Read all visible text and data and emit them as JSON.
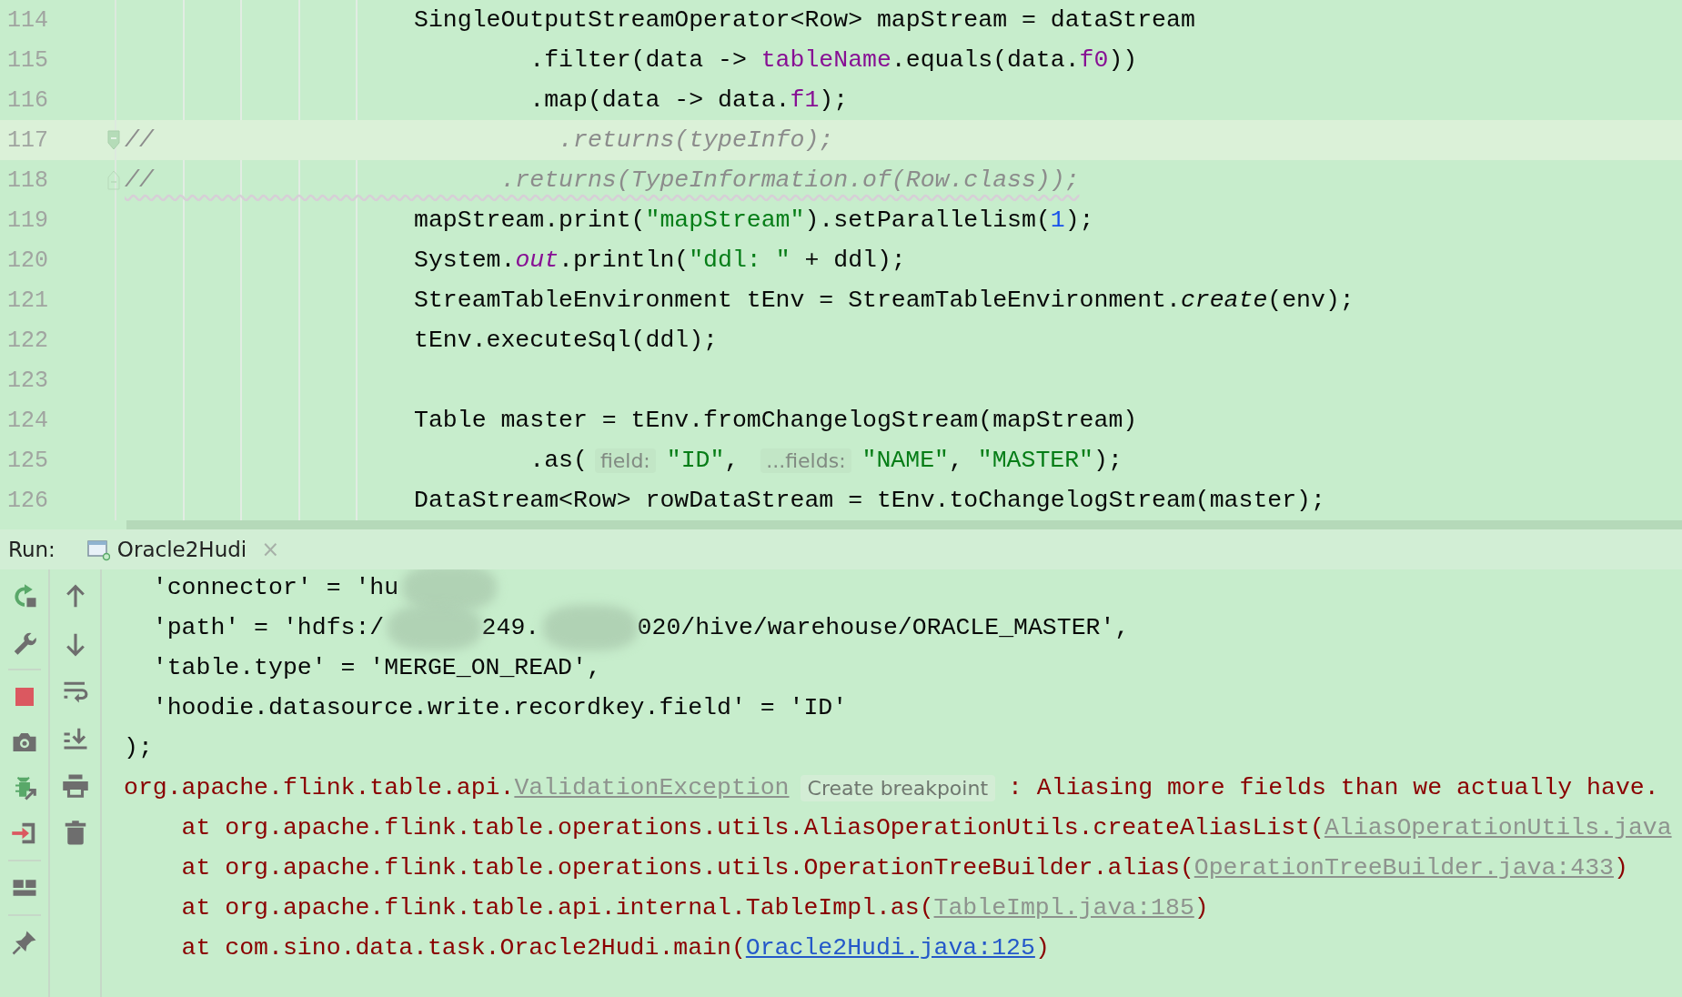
{
  "editor": {
    "lines": [
      {
        "number": "114",
        "kind": "code",
        "current": false,
        "warning": false,
        "tokens": [
          {
            "kind": "plain",
            "text": "                    SingleOutputStreamOperator<Row> mapStream = dataStream"
          }
        ]
      },
      {
        "number": "115",
        "kind": "code",
        "current": false,
        "warning": false,
        "tokens": [
          {
            "kind": "plain",
            "text": "                            .filter(data -> "
          },
          {
            "kind": "field",
            "text": "tableName"
          },
          {
            "kind": "plain",
            "text": ".equals(data."
          },
          {
            "kind": "field",
            "text": "f0"
          },
          {
            "kind": "plain",
            "text": "))"
          }
        ]
      },
      {
        "number": "116",
        "kind": "code",
        "current": false,
        "warning": false,
        "tokens": [
          {
            "kind": "plain",
            "text": "                            .map(data -> data."
          },
          {
            "kind": "field",
            "text": "f1"
          },
          {
            "kind": "plain",
            "text": ");"
          }
        ]
      },
      {
        "number": "117",
        "kind": "fold-start",
        "current": true,
        "warning": false,
        "tokens": [
          {
            "kind": "comment",
            "text": "//                            .returns(typeInfo);"
          }
        ]
      },
      {
        "number": "118",
        "kind": "fold-end",
        "current": false,
        "warning": true,
        "tokens": [
          {
            "kind": "comment",
            "text": "//                        .returns(TypeInformation.of(Row.class));"
          }
        ]
      },
      {
        "number": "119",
        "kind": "code",
        "current": false,
        "warning": false,
        "tokens": [
          {
            "kind": "plain",
            "text": "                    mapStream.print("
          },
          {
            "kind": "string",
            "text": "\"mapStream\""
          },
          {
            "kind": "plain",
            "text": ").setParallelism("
          },
          {
            "kind": "number",
            "text": "1"
          },
          {
            "kind": "plain",
            "text": ");"
          }
        ]
      },
      {
        "number": "120",
        "kind": "code",
        "current": false,
        "warning": false,
        "tokens": [
          {
            "kind": "plain",
            "text": "                    System."
          },
          {
            "kind": "static",
            "text": "out"
          },
          {
            "kind": "plain",
            "text": ".println("
          },
          {
            "kind": "string",
            "text": "\"ddl: \""
          },
          {
            "kind": "plain",
            "text": " + ddl);"
          }
        ]
      },
      {
        "number": "121",
        "kind": "code",
        "current": false,
        "warning": false,
        "tokens": [
          {
            "kind": "plain",
            "text": "                    StreamTableEnvironment tEnv = StreamTableEnvironment."
          },
          {
            "kind": "method",
            "text": "create"
          },
          {
            "kind": "plain",
            "text": "(env);"
          }
        ]
      },
      {
        "number": "122",
        "kind": "code",
        "current": false,
        "warning": false,
        "tokens": [
          {
            "kind": "plain",
            "text": "                    tEnv.executeSql(ddl);"
          }
        ]
      },
      {
        "number": "123",
        "kind": "code",
        "current": false,
        "warning": false
      },
      {
        "number": "124",
        "kind": "code",
        "current": false,
        "warning": false,
        "tokens": [
          {
            "kind": "plain",
            "text": "                    Table master = tEnv.fromChangelogStream(mapStream)"
          }
        ]
      },
      {
        "number": "125",
        "kind": "code",
        "current": false,
        "warning": false,
        "tokens": [
          {
            "kind": "plain",
            "text": "                            .as("
          },
          {
            "kind": "hint",
            "text": "field:"
          },
          {
            "kind": "string",
            "text": "\"ID\""
          },
          {
            "kind": "plain",
            "text": ", "
          },
          {
            "kind": "hint",
            "text": "...fields:"
          },
          {
            "kind": "string",
            "text": "\"NAME\""
          },
          {
            "kind": "plain",
            "text": ", "
          },
          {
            "kind": "string",
            "text": "\"MASTER\""
          },
          {
            "kind": "plain",
            "text": ");"
          }
        ]
      },
      {
        "number": "126",
        "kind": "code",
        "current": false,
        "warning": false,
        "tokens": [
          {
            "kind": "plain",
            "text": "                    DataStream<Row> rowDataStream = tEnv.toChangelogStream(master);"
          }
        ]
      }
    ]
  },
  "run_panel": {
    "label": "Run:",
    "tab": {
      "title": "Oracle2Hudi",
      "close": "×"
    },
    "console": [
      {
        "tokens": [
          {
            "kind": "plain",
            "text": "  'connector' = 'hu"
          },
          {
            "kind": "redacted"
          }
        ]
      },
      {
        "tokens": [
          {
            "kind": "plain",
            "text": "  'path' = 'hdfs:/"
          },
          {
            "kind": "redacted"
          },
          {
            "kind": "plain",
            "text": "249."
          },
          {
            "kind": "redacted"
          },
          {
            "kind": "plain",
            "text": "020/hive/warehouse/ORACLE_MASTER',"
          }
        ]
      },
      {
        "tokens": [
          {
            "kind": "plain",
            "text": "  'table.type' = 'MERGE_ON_READ',"
          }
        ]
      },
      {
        "tokens": [
          {
            "kind": "plain",
            "text": "  'hoodie.datasource.write.recordkey.field' = 'ID'"
          }
        ]
      },
      {
        "tokens": [
          {
            "kind": "plain",
            "text": ");"
          }
        ]
      },
      {
        "tokens": [
          {
            "kind": "error",
            "text": "org.apache.flink.table.api."
          },
          {
            "kind": "link",
            "text": "ValidationException"
          },
          {
            "kind": "hint",
            "text": "Create breakpoint"
          },
          {
            "kind": "error",
            "text": ": Aliasing more fields than we actually have."
          }
        ]
      },
      {
        "tokens": [
          {
            "kind": "error",
            "text": "    at org.apache.flink.table.operations.utils.AliasOperationUtils.createAliasList("
          },
          {
            "kind": "link",
            "text": "AliasOperationUtils.java"
          }
        ]
      },
      {
        "tokens": [
          {
            "kind": "error",
            "text": "    at org.apache.flink.table.operations.utils.OperationTreeBuilder.alias("
          },
          {
            "kind": "link",
            "text": "OperationTreeBuilder.java:433"
          },
          {
            "kind": "error",
            "text": ")"
          }
        ]
      },
      {
        "tokens": [
          {
            "kind": "error",
            "text": "    at org.apache.flink.table.api.internal.TableImpl.as("
          },
          {
            "kind": "link",
            "text": "TableImpl.java:185"
          },
          {
            "kind": "error",
            "text": ")"
          }
        ]
      },
      {
        "tokens": [
          {
            "kind": "error",
            "text": "    at com.sino.data.task.Oracle2Hudi.main("
          },
          {
            "kind": "source-link",
            "text": "Oracle2Hudi.java:125"
          },
          {
            "kind": "error",
            "text": ")"
          }
        ]
      }
    ]
  }
}
